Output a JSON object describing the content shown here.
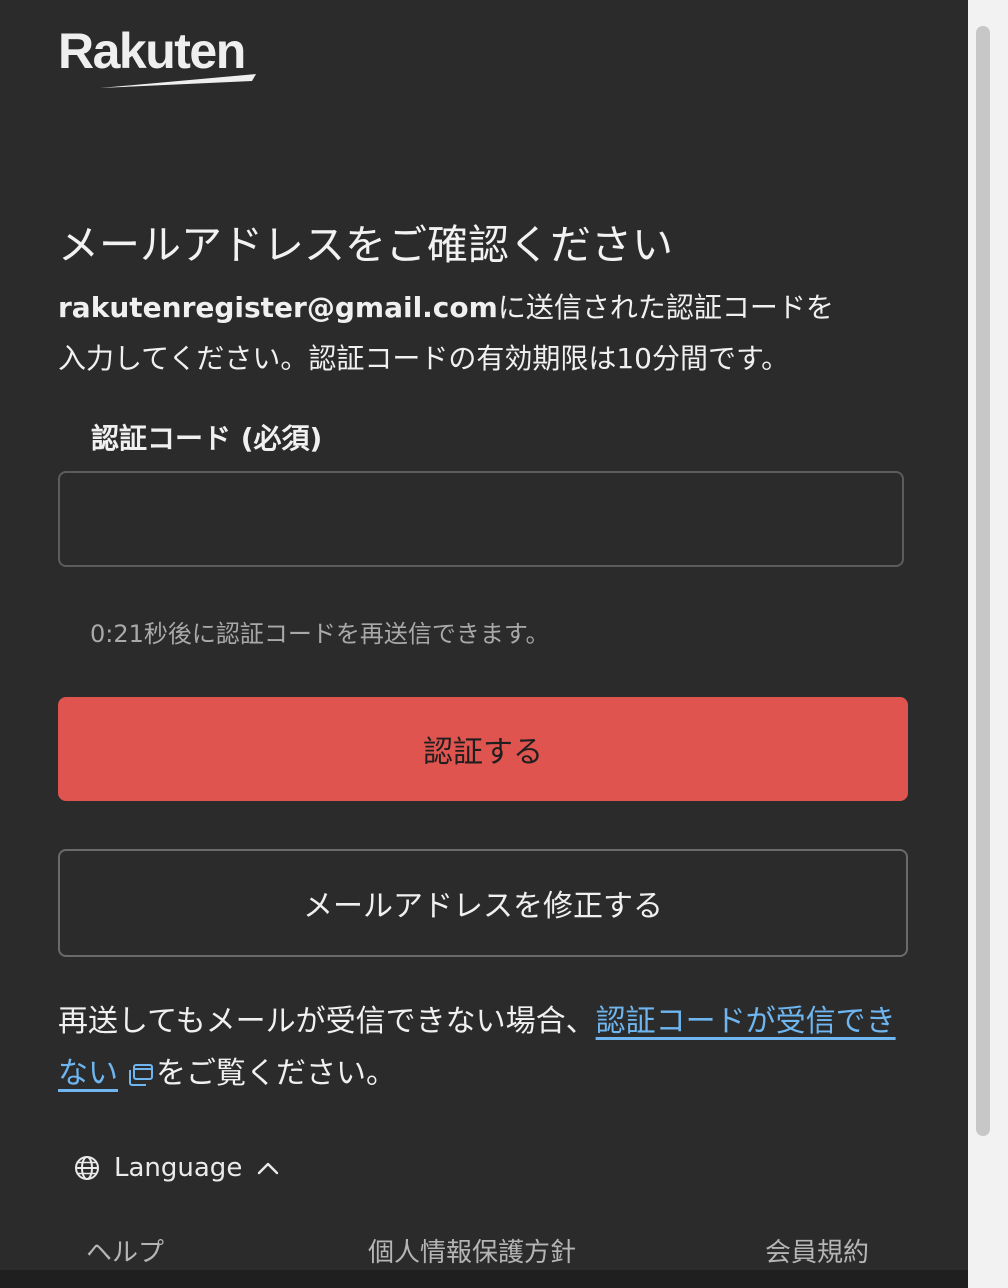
{
  "brand": {
    "logo_text": "Rakuten"
  },
  "page": {
    "title": "メールアドレスをご確認ください",
    "email": "rakutenregister@gmail.com",
    "description_line1_rest": "に送信された認証コードを",
    "description_line2": "入力してください。認証コードの有効期限は10分間です。"
  },
  "form": {
    "code_label": "認証コード (必須)",
    "code_value": "",
    "resend_note": "0:21秒後に認証コードを再送信できます。",
    "verify_label": "認証する",
    "edit_email_label": "メールアドレスを修正する"
  },
  "help": {
    "prefix": "再送してもメールが受信できない場合、",
    "link_text": "認証コードが受信できない",
    "suffix": "をご覧ください。"
  },
  "language": {
    "label": "Language"
  },
  "footer": {
    "help": "ヘルプ",
    "privacy": "個人情報保護方針",
    "terms": "会員規約"
  },
  "colors": {
    "background": "#2b2b2b",
    "primary_button": "#df544f",
    "link": "#6fb6f0",
    "muted_text": "#a9a9a9"
  }
}
